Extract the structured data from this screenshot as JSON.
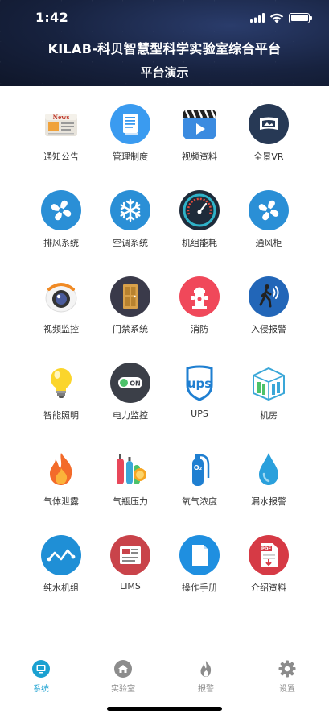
{
  "status_bar": {
    "time": "1:42"
  },
  "header": {
    "title": "KILAB-科贝智慧型科学实验室综合平台",
    "subtitle": "平台演示"
  },
  "modules": [
    {
      "label": "通知公告",
      "icon": "news-icon"
    },
    {
      "label": "管理制度",
      "icon": "document-icon"
    },
    {
      "label": "视频资料",
      "icon": "video-clapper-icon"
    },
    {
      "label": "全景VR",
      "icon": "vr-panorama-icon"
    },
    {
      "label": "排风系统",
      "icon": "exhaust-fan-icon"
    },
    {
      "label": "空调系统",
      "icon": "snowflake-icon"
    },
    {
      "label": "机组能耗",
      "icon": "gauge-icon"
    },
    {
      "label": "通风柜",
      "icon": "fume-hood-fan-icon"
    },
    {
      "label": "视频监控",
      "icon": "camera-icon"
    },
    {
      "label": "门禁系统",
      "icon": "door-icon"
    },
    {
      "label": "消防",
      "icon": "fire-hydrant-icon"
    },
    {
      "label": "入侵报警",
      "icon": "intruder-icon"
    },
    {
      "label": "智能照明",
      "icon": "light-bulb-icon"
    },
    {
      "label": "电力监控",
      "icon": "power-switch-icon"
    },
    {
      "label": "UPS",
      "icon": "ups-logo-icon"
    },
    {
      "label": "机房",
      "icon": "server-room-icon"
    },
    {
      "label": "气体泄露",
      "icon": "flame-icon"
    },
    {
      "label": "气瓶压力",
      "icon": "gas-cylinder-icon"
    },
    {
      "label": "氧气浓度",
      "icon": "oxygen-tank-icon"
    },
    {
      "label": "漏水报警",
      "icon": "water-drop-icon"
    },
    {
      "label": "纯水机组",
      "icon": "water-wave-icon"
    },
    {
      "label": "LIMS",
      "icon": "lims-icon"
    },
    {
      "label": "操作手册",
      "icon": "manual-icon"
    },
    {
      "label": "介绍资料",
      "icon": "pdf-icon"
    }
  ],
  "tabs": [
    {
      "label": "系统",
      "icon": "monitor-icon",
      "active": true
    },
    {
      "label": "实验室",
      "icon": "home-icon",
      "active": false
    },
    {
      "label": "报警",
      "icon": "alarm-flame-icon",
      "active": false
    },
    {
      "label": "设置",
      "icon": "gear-icon",
      "active": false
    }
  ],
  "colors": {
    "accent": "#1aa1d1",
    "header_dark": "#17223f",
    "tab_inactive": "#8c8c8c"
  }
}
